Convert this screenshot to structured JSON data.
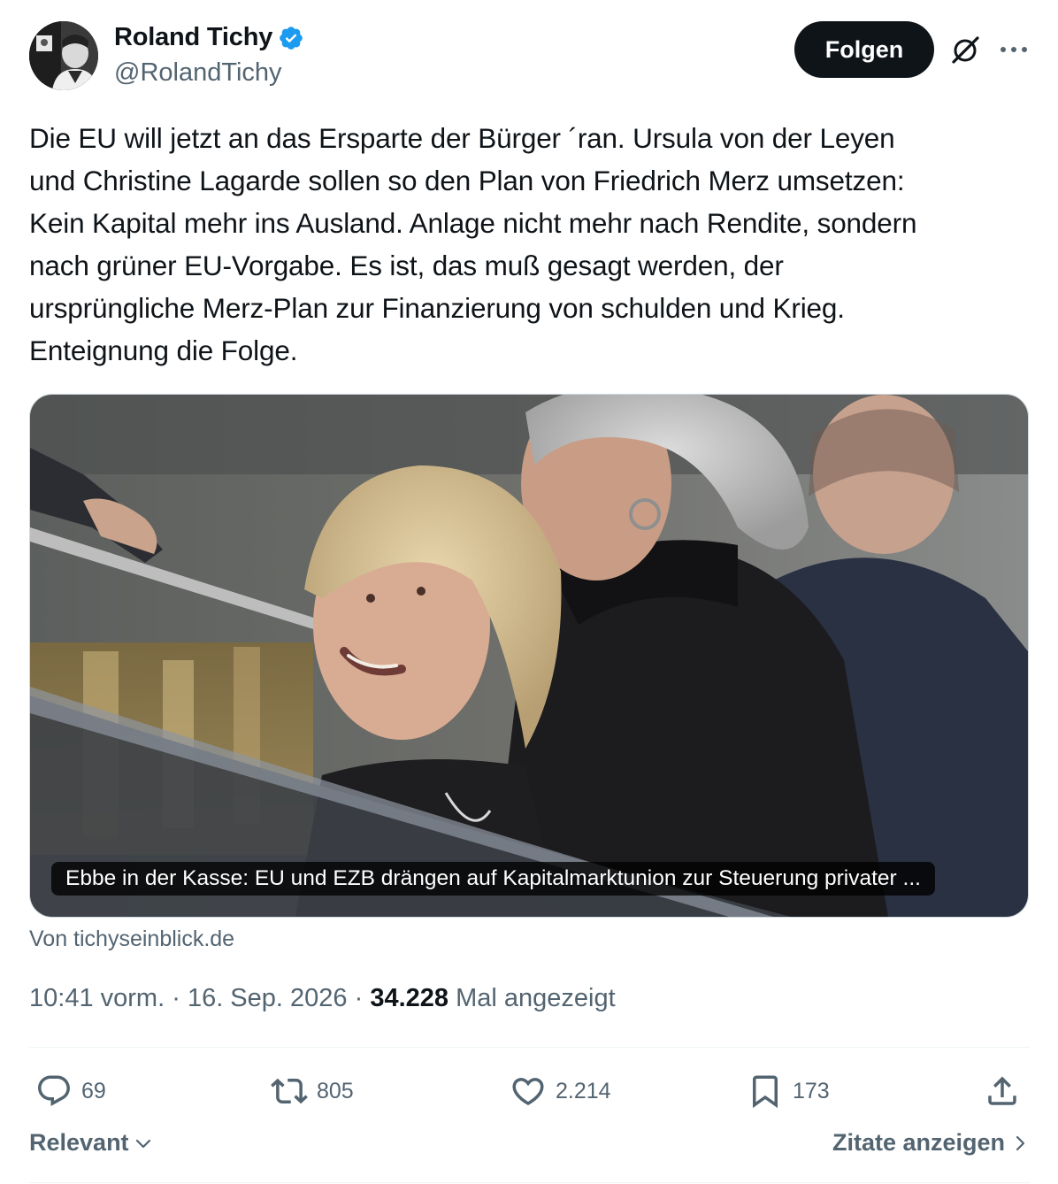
{
  "author": {
    "name": "Roland Tichy",
    "handle": "@RolandTichy",
    "verified": true,
    "verified_color": "#1d9bf0"
  },
  "header": {
    "follow_label": "Folgen",
    "grok_icon": "grok-icon",
    "more_icon": "more-icon"
  },
  "tweet": {
    "text": "Die EU will jetzt an das Ersparte der Bürger ´ran. Ursula von der Leyen\nund Christine Lagarde sollen so den Plan von Friedrich Merz umsetzen:\nKein Kapital mehr ins Ausland. Anlage nicht mehr nach Rendite, sondern\nnach grüner EU-Vorgabe. Es ist, das muß gesagt werden, der\nursprüngliche Merz-Plan zur Finanzierung von schulden und Krieg.\nEnteignung die Folge."
  },
  "card": {
    "caption": "Ebbe in der Kasse: EU und EZB drängen auf Kapitalmarktunion zur Steuerung privater ...",
    "source": "Von tichyseinblick.de"
  },
  "meta": {
    "time": "10:41 vorm.",
    "separator": "·",
    "date": "16. Sep. 2026",
    "views_count": "34.228",
    "views_label": "Mal angezeigt"
  },
  "actions": {
    "replies": "69",
    "reposts": "805",
    "likes": "2.214",
    "bookmarks": "173"
  },
  "footer": {
    "sort_label": "Relevant",
    "quotes_label": "Zitate anzeigen"
  }
}
